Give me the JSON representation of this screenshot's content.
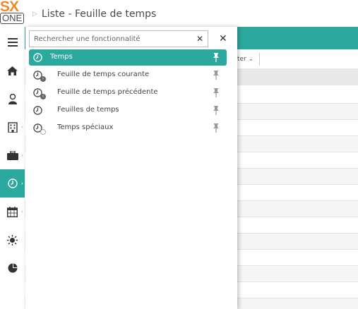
{
  "app": {
    "logo_top": "SX",
    "logo_bottom": "ONE",
    "brand_color": "#f0892a",
    "accent_color": "#2ba99e"
  },
  "breadcrumb": {
    "title": "Liste - Feuille de temps"
  },
  "sidebar": {
    "items": [
      {
        "name": "menu",
        "icon": "hamburger-icon"
      },
      {
        "name": "home",
        "icon": "home-icon"
      },
      {
        "name": "user",
        "icon": "user-icon"
      },
      {
        "name": "building",
        "icon": "building-icon"
      },
      {
        "name": "briefcase",
        "icon": "briefcase-icon"
      },
      {
        "name": "time",
        "icon": "clock-icon",
        "active": true
      },
      {
        "name": "calendar",
        "icon": "calendar-icon"
      },
      {
        "name": "sun",
        "icon": "sun-icon"
      },
      {
        "name": "chart",
        "icon": "pie-chart-icon"
      }
    ]
  },
  "background": {
    "toolbar_fragment": "ter"
  },
  "panel": {
    "search": {
      "placeholder": "Rechercher une fonctionnalité",
      "value": ""
    },
    "items": [
      {
        "label": "Temps",
        "icon": "clock-icon",
        "active": true
      },
      {
        "label": "Feuille de temps courante",
        "icon": "clock-icon",
        "badge": "next-icon"
      },
      {
        "label": "Feuille de temps précédente",
        "icon": "clock-icon",
        "badge": "previous-icon"
      },
      {
        "label": "Feuilles de temps",
        "icon": "clock-icon"
      },
      {
        "label": "Temps spéciaux",
        "icon": "clock-icon",
        "badge": "timer-icon"
      }
    ]
  }
}
